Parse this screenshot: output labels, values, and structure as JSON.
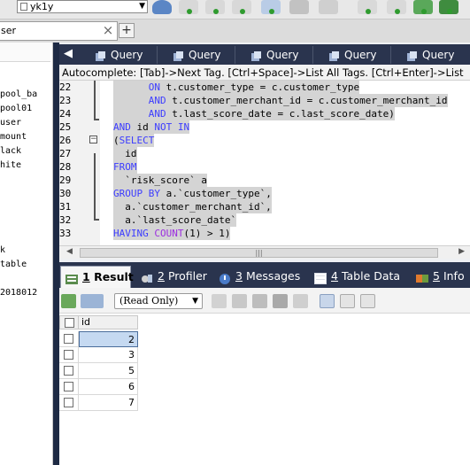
{
  "toolbar": {
    "database": "yk1y"
  },
  "tabs": {
    "left_tab_label": "ser",
    "close_glyph": "×",
    "add_glyph": "+"
  },
  "object_browser": {
    "items": [
      "pool_ba",
      "pool01",
      "user",
      "mount",
      "lack",
      "hite",
      "k",
      "table",
      "2018012"
    ]
  },
  "query_tabs": {
    "labels": [
      "Query",
      "Query",
      "Query",
      "Query",
      "Query"
    ]
  },
  "autocomplete": "Autocomplete: [Tab]->Next Tag. [Ctrl+Space]->List All Tags. [Ctrl+Enter]->List",
  "editor": {
    "line_numbers": [
      "22",
      "23",
      "24",
      "25",
      "26",
      "27",
      "28",
      "29",
      "30",
      "31",
      "32",
      "33"
    ],
    "lines": [
      [
        {
          "t": "      ",
          "c": ""
        },
        {
          "t": "ON",
          "c": "kw"
        },
        {
          "t": " t.customer_type = c.customer_type",
          "c": ""
        }
      ],
      [
        {
          "t": "      ",
          "c": ""
        },
        {
          "t": "AND",
          "c": "kw"
        },
        {
          "t": " t.customer_merchant_id = c.customer_merchant_id",
          "c": ""
        }
      ],
      [
        {
          "t": "      ",
          "c": ""
        },
        {
          "t": "AND",
          "c": "kw"
        },
        {
          "t": " t.last_score_date = c.last_score_date)",
          "c": ""
        }
      ],
      [
        {
          "t": "AND",
          "c": "kw"
        },
        {
          "t": " id ",
          "c": ""
        },
        {
          "t": "NOT IN",
          "c": "kw"
        }
      ],
      [
        {
          "t": "(",
          "c": ""
        },
        {
          "t": "SELECT",
          "c": "kw"
        }
      ],
      [
        {
          "t": "  id",
          "c": ""
        }
      ],
      [
        {
          "t": "FROM",
          "c": "kw"
        }
      ],
      [
        {
          "t": "  `risk_score` a",
          "c": ""
        }
      ],
      [
        {
          "t": "GROUP BY",
          "c": "kw"
        },
        {
          "t": " a.`customer_type`,",
          "c": ""
        }
      ],
      [
        {
          "t": "  a.`customer_merchant_id`,",
          "c": ""
        }
      ],
      [
        {
          "t": "  a.`last_score_date`",
          "c": ""
        }
      ],
      [
        {
          "t": "HAVING",
          "c": "kw"
        },
        {
          "t": " ",
          "c": ""
        },
        {
          "t": "COUNT",
          "c": "kp"
        },
        {
          "t": "(1) > 1)",
          "c": ""
        }
      ]
    ],
    "fold_open_glyph": "−",
    "scroll_grip": "|||",
    "scroll_left": "◀",
    "scroll_right": "▶"
  },
  "result_tabs": {
    "result": {
      "num": "1",
      "label": "Result"
    },
    "profiler": {
      "num": "2",
      "label": "Profiler"
    },
    "messages": {
      "num": "3",
      "label": "Messages"
    },
    "table_data": {
      "num": "4",
      "label": "Table Data"
    },
    "info": {
      "num": "5",
      "label": "Info"
    }
  },
  "result_toolbar": {
    "mode": "(Read Only)"
  },
  "grid": {
    "column": "id",
    "rows": [
      "2",
      "3",
      "5",
      "6",
      "7"
    ],
    "selected_row": 0
  },
  "colors": {
    "dark_bar": "#2a344e",
    "keyword": "#3c3cff",
    "function": "#9b2de0",
    "selection": "#d4d4d4",
    "cell_selection": "#c5d9f1"
  }
}
